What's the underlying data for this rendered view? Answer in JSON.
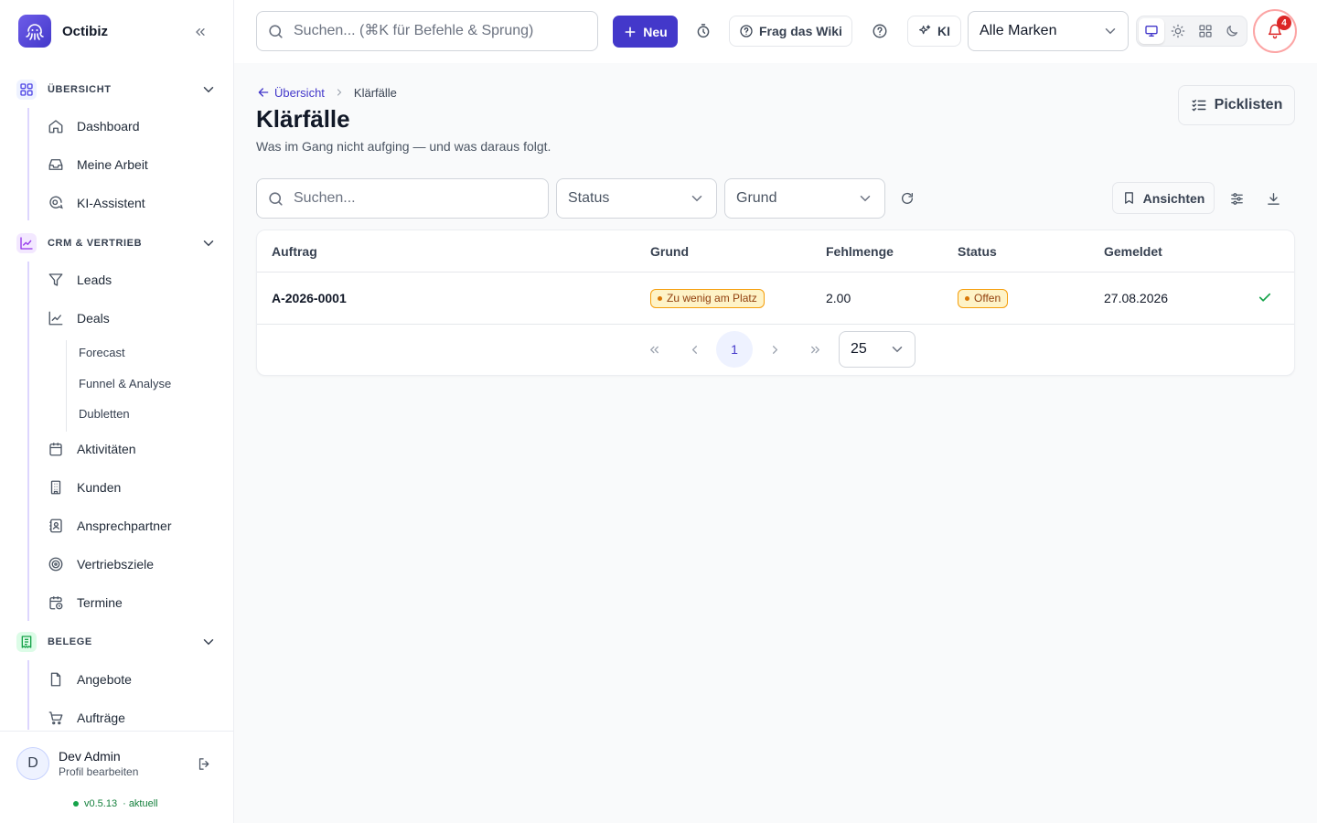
{
  "app": {
    "name": "Octibiz"
  },
  "topbar": {
    "search_placeholder": "Suchen... (⌘K für Befehle & Sprung)",
    "new_label": "Neu",
    "wiki_label": "Frag das Wiki",
    "ai_label": "KI",
    "brand_filter": "Alle Marken",
    "notification_count": "4"
  },
  "sidebar": {
    "groups": [
      {
        "label": "ÜBERSICHT",
        "items": [
          {
            "label": "Dashboard"
          },
          {
            "label": "Meine Arbeit"
          },
          {
            "label": "KI-Assistent"
          }
        ]
      },
      {
        "label": "CRM & VERTRIEB",
        "items": [
          {
            "label": "Leads"
          },
          {
            "label": "Deals"
          },
          {
            "label": "Aktivitäten"
          },
          {
            "label": "Kunden"
          },
          {
            "label": "Ansprechpartner"
          },
          {
            "label": "Vertriebsziele"
          },
          {
            "label": "Termine"
          }
        ],
        "subitems": [
          {
            "label": "Forecast"
          },
          {
            "label": "Funnel & Analyse"
          },
          {
            "label": "Dubletten"
          }
        ]
      },
      {
        "label": "BELEGE",
        "items": [
          {
            "label": "Angebote"
          },
          {
            "label": "Aufträge"
          }
        ]
      }
    ],
    "user": {
      "initial": "D",
      "name": "Dev Admin",
      "subtitle": "Profil bearbeiten"
    },
    "version": "v0.5.13",
    "version_status": "· aktuell"
  },
  "breadcrumb": {
    "back_label": "Übersicht",
    "current": "Klärfälle"
  },
  "page": {
    "title": "Klärfälle",
    "subtitle": "Was im Gang nicht aufging — und was daraus folgt.",
    "picklists_label": "Picklisten"
  },
  "filters": {
    "search_placeholder": "Suchen...",
    "status_placeholder": "Status",
    "reason_placeholder": "Grund",
    "views_label": "Ansichten"
  },
  "table": {
    "columns": [
      "Auftrag",
      "Grund",
      "Fehlmenge",
      "Status",
      "Gemeldet"
    ],
    "rows": [
      {
        "order": "A-2026-0001",
        "reason": "Zu wenig am Platz",
        "shortage": "2.00",
        "status": "Offen",
        "reported": "27.08.2026"
      }
    ]
  },
  "pagination": {
    "current_page": "1",
    "page_size": "25"
  },
  "colors": {
    "accent": "#4338ca",
    "warning_bg": "#fef3c7",
    "warning_border": "#f59e0b",
    "success": "#16a34a",
    "danger": "#dc2626"
  },
  "icons": [
    "octopus-logo-icon",
    "chevrons-left-icon",
    "search-icon",
    "plus-icon",
    "timer-icon",
    "help-circle-icon",
    "sparkles-icon",
    "chevron-down-icon",
    "monitor-icon",
    "sun-icon",
    "grid-icon",
    "moon-icon",
    "bell-icon",
    "arrow-left-icon",
    "chevron-right-icon",
    "list-checks-icon",
    "refresh-icon",
    "bookmark-icon",
    "sliders-icon",
    "download-icon",
    "check-icon",
    "logout-icon"
  ]
}
